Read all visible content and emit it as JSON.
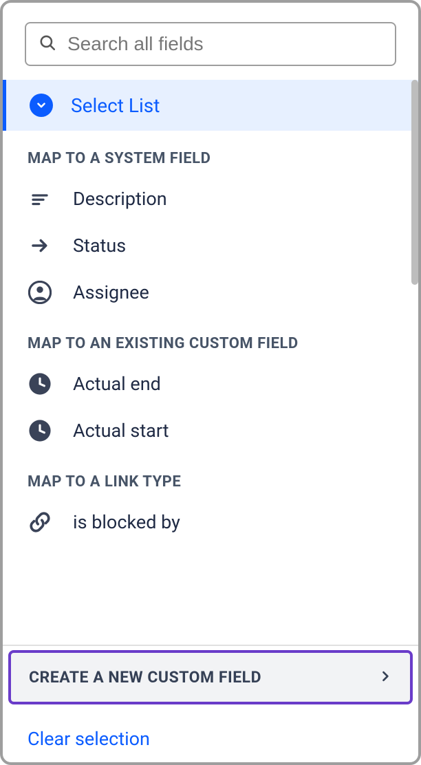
{
  "search": {
    "placeholder": "Search all fields"
  },
  "selected": {
    "label": "Select List"
  },
  "sections": {
    "system": {
      "header": "MAP TO A SYSTEM FIELD",
      "items": [
        {
          "label": "Description"
        },
        {
          "label": "Status"
        },
        {
          "label": "Assignee"
        }
      ]
    },
    "custom": {
      "header": "MAP TO AN EXISTING CUSTOM FIELD",
      "items": [
        {
          "label": "Actual end"
        },
        {
          "label": "Actual start"
        }
      ]
    },
    "link": {
      "header": "MAP TO A LINK TYPE",
      "items": [
        {
          "label": "is blocked by"
        }
      ]
    }
  },
  "footer": {
    "create_label": "CREATE A NEW CUSTOM FIELD",
    "clear_label": "Clear selection"
  }
}
